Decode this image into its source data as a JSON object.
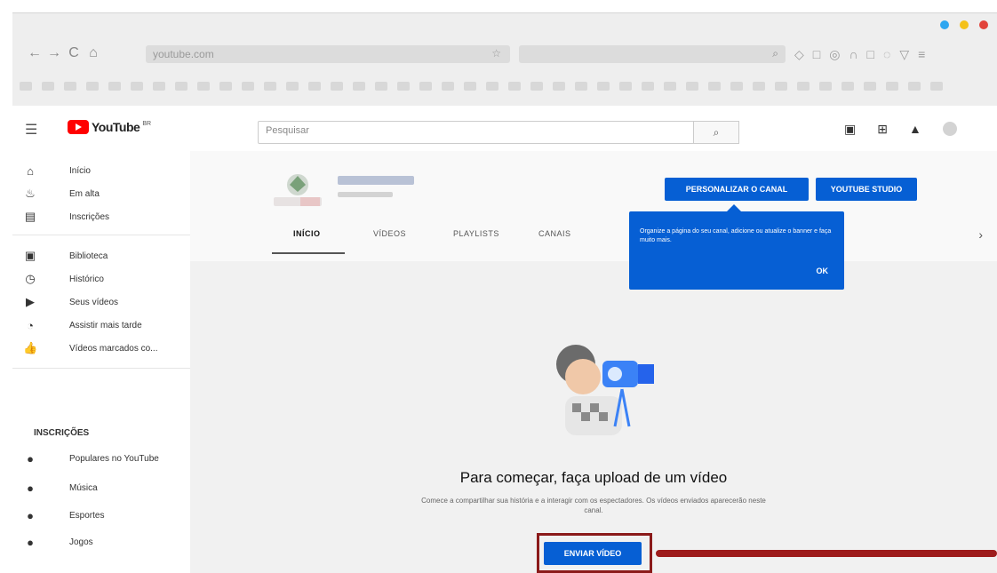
{
  "browser": {
    "url": "youtube.com",
    "window_colors": [
      "#2ea6f0",
      "#f4c11a",
      "#e2423a"
    ]
  },
  "youtube": {
    "logo_text": "YouTube",
    "logo_sup": "BR",
    "search_placeholder": "Pesquisar"
  },
  "sidebar": {
    "items": [
      {
        "icon": "home-icon",
        "label": "Início"
      },
      {
        "icon": "fire-icon",
        "label": "Em alta"
      },
      {
        "icon": "subscriptions-icon",
        "label": "Inscrições"
      },
      {
        "icon": "library-icon",
        "label": "Biblioteca"
      },
      {
        "icon": "history-icon",
        "label": "Histórico"
      },
      {
        "icon": "your-videos-icon",
        "label": "Seus vídeos"
      },
      {
        "icon": "watch-later-icon",
        "label": "Assistir mais tarde"
      },
      {
        "icon": "liked-videos-icon",
        "label": "Vídeos marcados co..."
      }
    ],
    "subscriptions_heading": "INSCRIÇÕES",
    "subscriptions": [
      {
        "icon": "popular-channel-icon",
        "label": "Populares no YouTube"
      },
      {
        "icon": "music-channel-icon",
        "label": "Música"
      },
      {
        "icon": "sports-channel-icon",
        "label": "Esportes"
      },
      {
        "icon": "gaming-channel-icon",
        "label": "Jogos"
      }
    ]
  },
  "channel": {
    "customize_button": "PERSONALIZAR O CANAL",
    "studio_button": "YOUTUBE STUDIO",
    "tabs": [
      "INÍCIO",
      "VÍDEOS",
      "PLAYLISTS",
      "CANAIS"
    ],
    "active_tab": "INÍCIO",
    "tooltip_text": "Organize a página do seu canal, adicione ou atualize o banner e faça muito mais.",
    "tooltip_ok": "OK"
  },
  "empty_state": {
    "title": "Para começar, faça upload de um vídeo",
    "description": "Comece a compartilhar sua história e a interagir com os espectadores. Os vídeos enviados aparecerão neste canal.",
    "upload_button": "ENVIAR VÍDEO"
  },
  "colors": {
    "accent": "#065fd4",
    "brand": "#ff0000",
    "highlight": "#8b1a1a"
  }
}
